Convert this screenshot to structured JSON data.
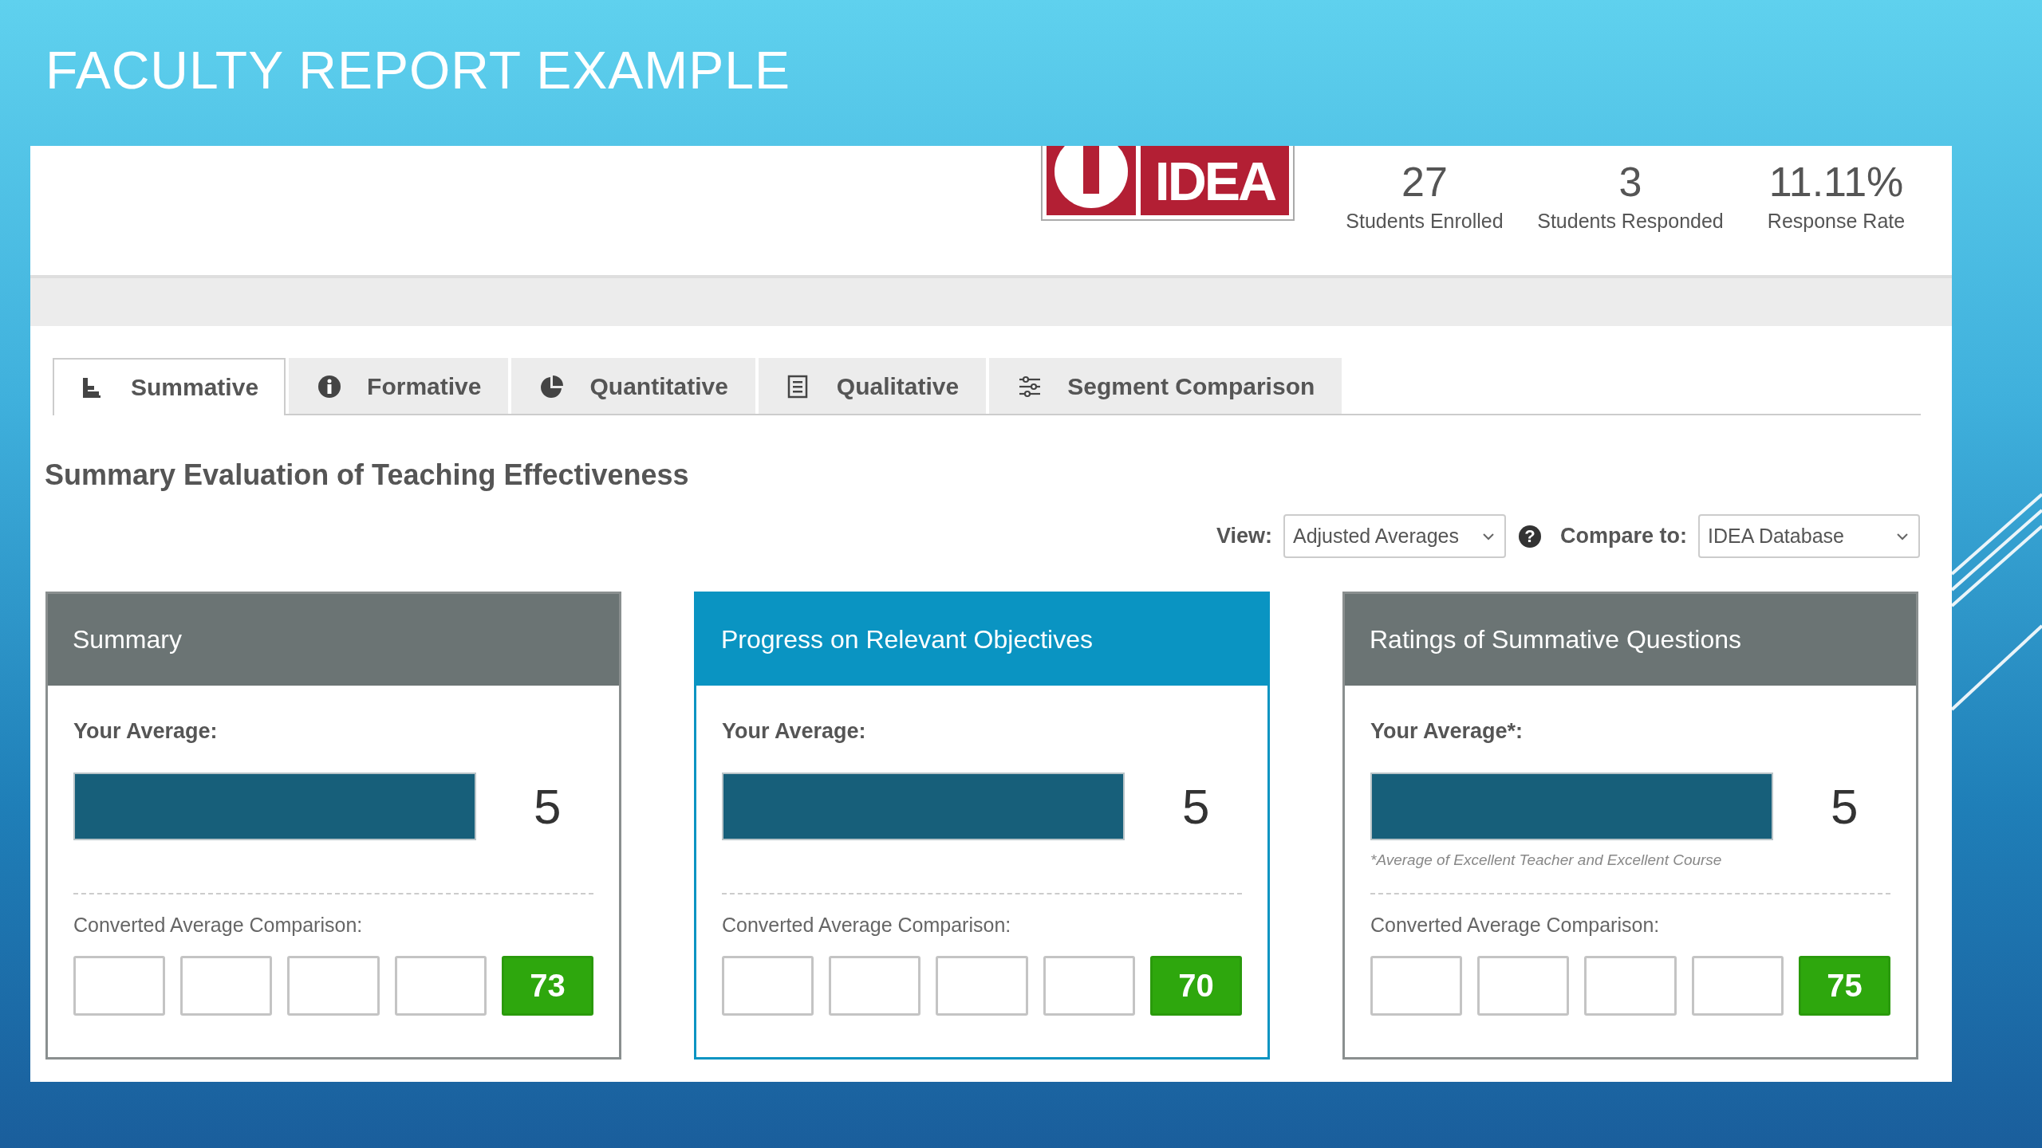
{
  "slide": {
    "title": "FACULTY REPORT EXAMPLE"
  },
  "header": {
    "logo": {
      "text": "IDEA"
    },
    "stats": [
      {
        "value": "27",
        "label": "Students Enrolled"
      },
      {
        "value": "3",
        "label": "Students Responded"
      },
      {
        "value": "11.11%",
        "label": "Response Rate"
      }
    ]
  },
  "tabs": [
    {
      "label": "Summative",
      "kind": "bars",
      "selected": true
    },
    {
      "label": "Formative",
      "kind": "info",
      "selected": false
    },
    {
      "label": "Quantitative",
      "kind": "pie",
      "selected": false
    },
    {
      "label": "Qualitative",
      "kind": "document",
      "selected": false
    },
    {
      "label": "Segment Comparison",
      "kind": "sliders",
      "selected": false
    }
  ],
  "section_title": "Summary Evaluation of Teaching Effectiveness",
  "filters": {
    "view": {
      "label": "View:",
      "value": "Adjusted Averages"
    },
    "help": "?",
    "compare": {
      "label": "Compare to:",
      "value": "IDEA Database"
    }
  },
  "cards": [
    {
      "title": "Summary",
      "highlighted": false,
      "average_label": "Your Average:",
      "score": "5",
      "comparison_label": "Converted Average Comparison:",
      "boxes": [
        {
          "filled": false
        },
        {
          "filled": false
        },
        {
          "filled": false
        },
        {
          "filled": false
        },
        {
          "filled": true,
          "text": "73"
        }
      ]
    },
    {
      "title": "Progress on Relevant Objectives",
      "highlighted": true,
      "average_label": "Your Average:",
      "score": "5",
      "comparison_label": "Converted Average Comparison:",
      "boxes": [
        {
          "filled": false
        },
        {
          "filled": false
        },
        {
          "filled": false
        },
        {
          "filled": false
        },
        {
          "filled": true,
          "text": "70"
        }
      ]
    },
    {
      "title": "Ratings of Summative Questions",
      "highlighted": false,
      "average_label": "Your Average*:",
      "score": "5",
      "footnote": "*Average of Excellent Teacher and Excellent Course",
      "comparison_label": "Converted Average Comparison:",
      "boxes": [
        {
          "filled": false
        },
        {
          "filled": false
        },
        {
          "filled": false
        },
        {
          "filled": false
        },
        {
          "filled": true,
          "text": "75"
        }
      ]
    }
  ]
}
